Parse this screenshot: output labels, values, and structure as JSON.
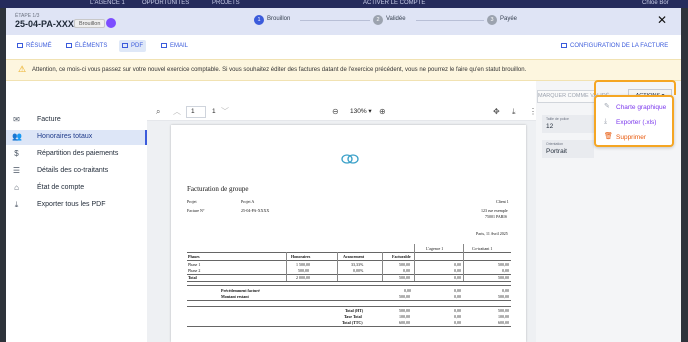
{
  "topbar": {
    "agency": "L'AGENCE 1",
    "opportunites": "OPPORTUNITÉS",
    "projets": "PROJETS",
    "activate": "ACTIVER LE COMPTE",
    "user": "Chloé Bor"
  },
  "header": {
    "step_small": "ÉTAPE 1/3",
    "doc_id": "25-04-PA-XXXX",
    "badge": "Brouillon",
    "steps": [
      {
        "num": "1",
        "label": "Brouillon"
      },
      {
        "num": "2",
        "label": "Validée"
      },
      {
        "num": "3",
        "label": "Payée"
      }
    ],
    "close": "✕"
  },
  "tabs": {
    "resume": "RÉSUMÉ",
    "elements": "ÉLÉMENTS",
    "pdf": "PDF",
    "email": "EMAIL",
    "config": "CONFIGURATION DE LA FACTURE"
  },
  "warning": {
    "icon": "⚠",
    "text": "Attention, ce mois-ci vous passez sur votre nouvel exercice comptable. Si vous souhaitez éditer des factures datant de l'exercice précédent, vous ne pourrez le faire qu'en statut brouillon."
  },
  "sidebar": {
    "items": [
      {
        "icon": "mail-icon",
        "label": "Facture"
      },
      {
        "icon": "users-icon",
        "label": "Honoraires totaux"
      },
      {
        "icon": "money-icon",
        "label": "Répartition des paiements"
      },
      {
        "icon": "list-icon",
        "label": "Détails des co-traitants"
      },
      {
        "icon": "bank-icon",
        "label": "État de compte"
      },
      {
        "icon": "download-icon",
        "label": "Exporter tous les PDF"
      }
    ]
  },
  "viewer": {
    "page": "1",
    "total": "1",
    "zoom": "130%"
  },
  "invoice": {
    "title": "Facturation de groupe",
    "projet_label": "Projet",
    "projet_value": "Projet A",
    "facture_label": "Facture N°",
    "facture_value": "25-04-PA-XXXX",
    "client_label": "Client 1",
    "client_addr1": "123 rue exemple",
    "client_addr2": "75001 PARIS",
    "date": "Paris, 11 Avril 2025",
    "group_headers": [
      "L'agence 1",
      "Co-traitant 1"
    ],
    "col_headers": [
      "Phases",
      "Honoraires",
      "Avancement",
      "Facturable"
    ],
    "rows": [
      [
        "Phase 1",
        "1 500,00",
        "33,33%",
        "500,00",
        "0,00",
        "500,00"
      ],
      [
        "Phase 2",
        "500,00",
        "0,00%",
        "0,00",
        "0,00",
        "0,00"
      ],
      [
        "Total",
        "2 000,00",
        "",
        "500,00",
        "0,00",
        "500,00"
      ]
    ],
    "prev": [
      [
        "Précédemment facturé",
        "0,00",
        "0,00",
        "0,00"
      ],
      [
        "Montant restant",
        "500,00",
        "0,00",
        "500,00"
      ]
    ],
    "totals": [
      [
        "Total (HT)",
        "500,00",
        "0,00",
        "500,00"
      ],
      [
        "Taxe Total",
        "100,00",
        "0,00",
        "100,00"
      ],
      [
        "Total (TTC)",
        "600,00",
        "0,00",
        "600,00"
      ]
    ]
  },
  "right_panel": {
    "mark_paid": "MARQUER COMME VALIDÉ",
    "actions": "ACTIONS",
    "field1_label": "Taille de police",
    "field1_value": "12",
    "field2_label": "Orientation",
    "field2_value": "Portrait"
  },
  "menu": {
    "items": [
      {
        "icon": "chart-icon",
        "label": "Charte graphique",
        "color": "#7c3aed"
      },
      {
        "icon": "download-icon",
        "label": "Exporter (.xls)",
        "color": "#7c3aed"
      },
      {
        "icon": "trash-icon",
        "label": "Supprimer",
        "color": "#e8590c"
      }
    ]
  },
  "colors": {
    "accent": "#3b5bdb",
    "highlight": "#f5a623",
    "menu_text": "#7c3aed",
    "header_bg": "#dfe4f5",
    "warning_bg": "#fdf6df"
  }
}
